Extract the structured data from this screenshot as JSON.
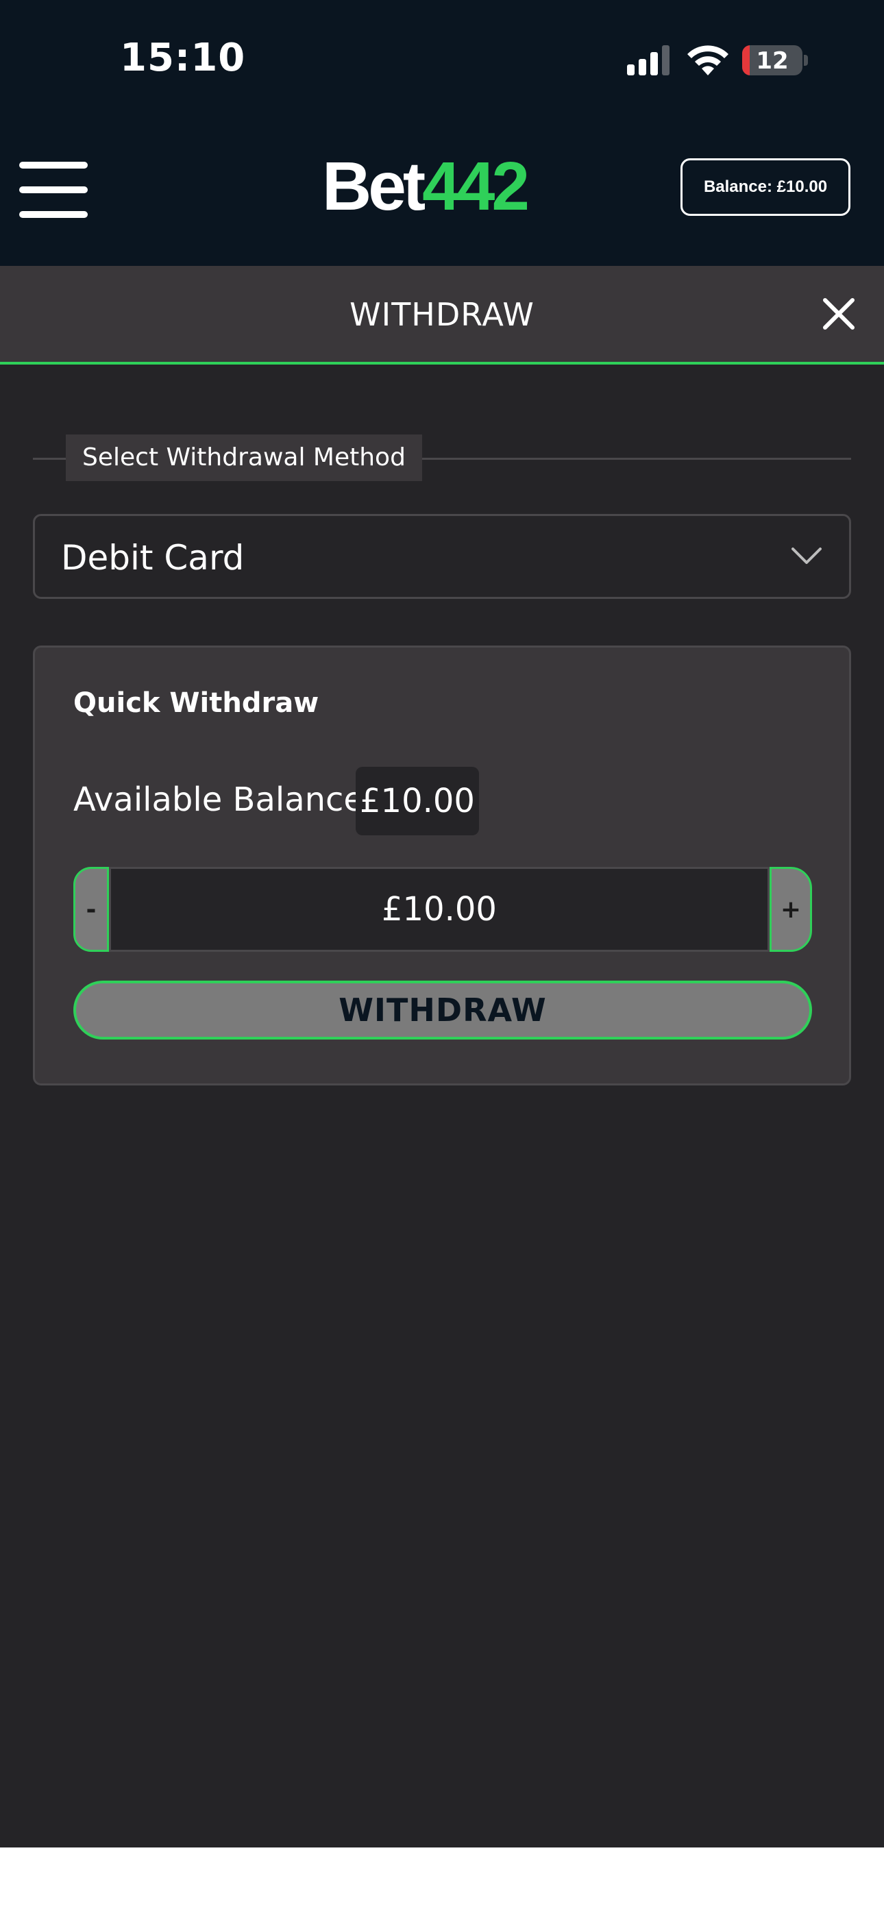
{
  "status_bar": {
    "time": "15:10",
    "battery_level": "12",
    "battery_fraction": 0.12,
    "signal_icon": "cellular-signal-icon",
    "wifi_icon": "wifi-icon",
    "battery_icon": "battery-charging-icon"
  },
  "header": {
    "logo_part1": "Bet",
    "logo_part2": "442",
    "balance_label": "Balance: £10.00",
    "menu_icon": "hamburger-menu-icon",
    "brand_color": "#2fd059",
    "background_color": "#0a1520"
  },
  "modal": {
    "title": "WITHDRAW",
    "close_icon": "close-icon",
    "method_legend": "Select Withdrawal Method",
    "method_selected": "Debit Card",
    "chevron_icon": "chevron-down-icon"
  },
  "quick_withdraw": {
    "title": "Quick Withdraw",
    "available_label": "Available Balance:",
    "available_value": "£10.00",
    "minus_label": "-",
    "plus_label": "+",
    "amount_value": "£10.00",
    "submit_label": "WITHDRAW"
  }
}
